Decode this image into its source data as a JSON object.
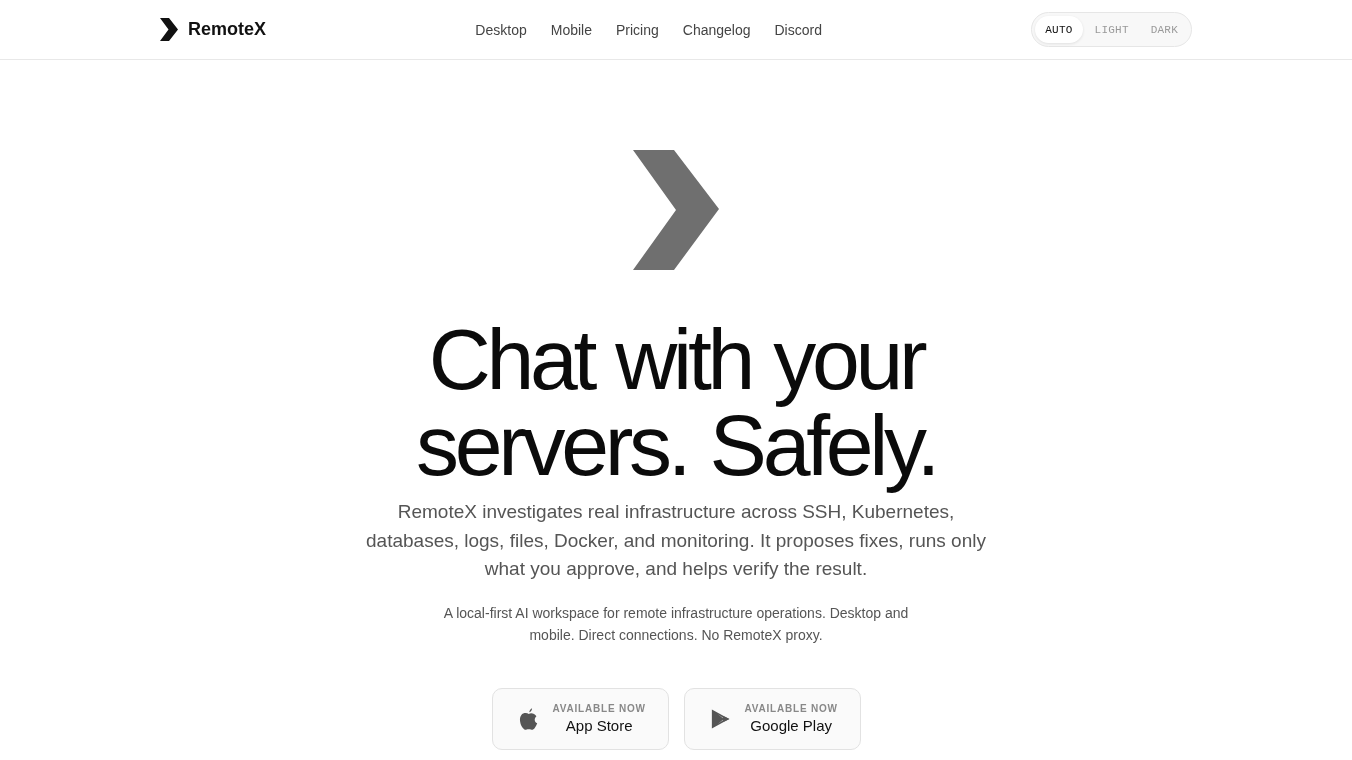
{
  "header": {
    "brand": "RemoteX",
    "nav": [
      {
        "label": "Desktop"
      },
      {
        "label": "Mobile"
      },
      {
        "label": "Pricing"
      },
      {
        "label": "Changelog"
      },
      {
        "label": "Discord"
      }
    ],
    "theme_options": [
      {
        "label": "AUTO",
        "selected": true
      },
      {
        "label": "LIGHT",
        "selected": false
      },
      {
        "label": "DARK",
        "selected": false
      }
    ]
  },
  "hero": {
    "headline": "Chat with your servers. Safely.",
    "subtitle": "RemoteX investigates real infrastructure across SSH, Kubernetes, databases, logs, files, Docker, and monitoring. It proposes fixes, runs only what you approve, and helps verify the result.",
    "note": "A local-first AI workspace for remote infrastructure operations. Desktop and mobile. Direct connections. No RemoteX proxy.",
    "store_buttons": [
      {
        "kind": "apple",
        "caption": "AVAILABLE NOW",
        "label": "App Store"
      },
      {
        "kind": "play",
        "caption": "AVAILABLE NOW",
        "label": "Google Play"
      }
    ]
  }
}
